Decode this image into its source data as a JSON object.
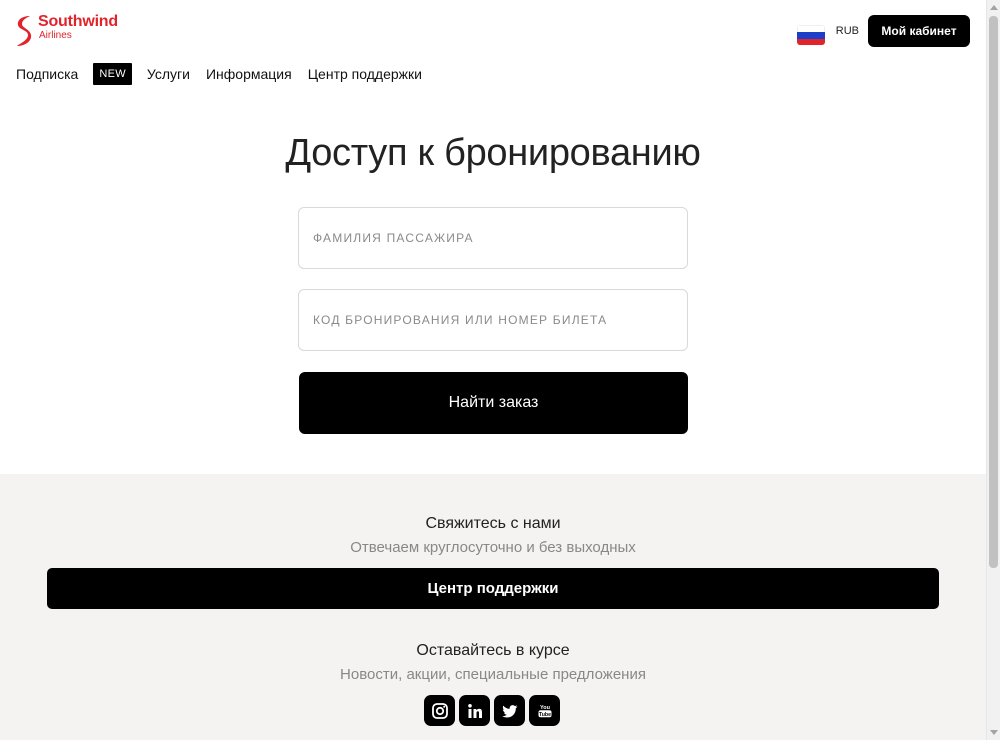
{
  "header": {
    "logo": {
      "name": "Southwind",
      "sub": "Airlines"
    },
    "currency": "RUB",
    "cabinet_label": "Мой кабинет"
  },
  "nav": {
    "items": [
      {
        "label": "Подписка"
      },
      {
        "label": "NEW"
      },
      {
        "label": "Услуги"
      },
      {
        "label": "Информация"
      },
      {
        "label": "Центр поддержки"
      }
    ]
  },
  "main": {
    "title": "Доступ к бронированию",
    "surname_placeholder": "Фамилия пассажира",
    "booking_placeholder": "Код бронирования или номер билета",
    "find_label": "Найти заказ"
  },
  "footer": {
    "contact_heading": "Свяжитесь с нами",
    "contact_sub": "Отвечаем круглосуточно и без выходных",
    "support_label": "Центр поддержки",
    "news_heading": "Оставайтесь в курсе",
    "news_sub": "Новости, акции, специальные предложения",
    "socials": [
      "instagram-icon",
      "linkedin-icon",
      "twitter-icon",
      "youtube-icon"
    ]
  },
  "colors": {
    "brand": "#e1242b",
    "button": "#000000",
    "footer_bg": "#f4f3f1"
  }
}
